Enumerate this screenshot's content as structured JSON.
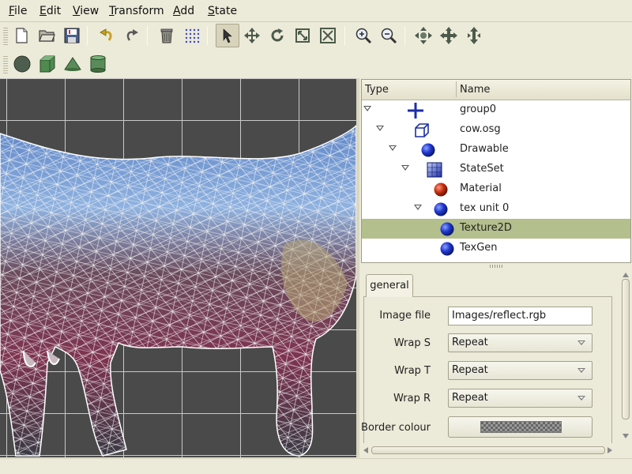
{
  "menu": [
    {
      "mnemonic": "F",
      "rest": "ile"
    },
    {
      "mnemonic": "E",
      "rest": "dit"
    },
    {
      "mnemonic": "V",
      "rest": "iew"
    },
    {
      "mnemonic": "T",
      "rest": "ransform"
    },
    {
      "mnemonic": "A",
      "rest": "dd"
    },
    {
      "mnemonic": "S",
      "rest": "tate"
    }
  ],
  "toolbar": {
    "main": [
      "new-file-icon",
      "open-folder-icon",
      "save-icon",
      "undo-icon",
      "redo-icon",
      "delete-trash-icon",
      "grid-icon",
      "select-pointer-icon",
      "translate-move-icon",
      "rotate-icon",
      "scale-icon",
      "scale-fit-icon",
      "zoom-in-icon",
      "zoom-out-icon",
      "pan-compass-icon",
      "move-cross-icon",
      "move-vertical-icon"
    ],
    "shapes": [
      "sphere-icon",
      "box-icon",
      "cone-icon",
      "cylinder-icon"
    ],
    "active_tool": "select-pointer-icon"
  },
  "tree": {
    "columns": {
      "type": "Type",
      "name": "Name"
    },
    "rows": [
      {
        "name": "group0",
        "icon": "group-cross-icon",
        "expanded": true,
        "selected": false
      },
      {
        "name": "cow.osg",
        "icon": "geode-cube-icon",
        "expanded": true,
        "selected": false
      },
      {
        "name": "Drawable",
        "icon": "drawable-sphere-icon",
        "expanded": true,
        "selected": false
      },
      {
        "name": "StateSet",
        "icon": "stateset-icon",
        "expanded": true,
        "selected": false
      },
      {
        "name": "Material",
        "icon": "material-sphere-icon",
        "expanded": false,
        "selected": false
      },
      {
        "name": "tex unit 0",
        "icon": "texunit-sphere-icon",
        "expanded": true,
        "selected": false
      },
      {
        "name": "Texture2D",
        "icon": "texture-sphere-icon",
        "expanded": false,
        "selected": true
      },
      {
        "name": "TexGen",
        "icon": "texgen-sphere-icon",
        "expanded": false,
        "selected": false
      }
    ]
  },
  "properties": {
    "tab": "general",
    "image_file": {
      "label": "Image file",
      "value": "Images/reflect.rgb"
    },
    "wrap_s": {
      "label": "Wrap S",
      "value": "Repeat"
    },
    "wrap_t": {
      "label": "Wrap T",
      "value": "Repeat"
    },
    "wrap_r": {
      "label": "Wrap R",
      "value": "Repeat"
    },
    "border_colour": {
      "label": "Border colour"
    }
  },
  "colors": {
    "selection": "#b3bf8c",
    "background": "#ecead8",
    "viewport": "#4a4a4a",
    "grid": "#c9c9c9"
  }
}
